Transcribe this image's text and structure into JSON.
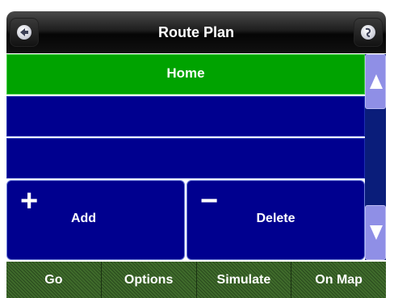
{
  "header": {
    "title": "Route Plan",
    "back_icon": "back-arrow-icon",
    "right_icon": "globe-icon"
  },
  "route_list": {
    "items": [
      {
        "label": "Home",
        "selected": true
      },
      {
        "label": ""
      },
      {
        "label": ""
      }
    ]
  },
  "actions": {
    "add_symbol": "+",
    "add_label": "Add",
    "delete_symbol": "−",
    "delete_label": "Delete"
  },
  "bottom_bar": {
    "buttons": [
      "Go",
      "Options",
      "Simulate",
      "On Map"
    ]
  },
  "colors": {
    "selected_row": "#00a300",
    "row": "#00008f",
    "scroll_button": "#8f8fe6",
    "bottom_bar": "#2f5a20"
  }
}
